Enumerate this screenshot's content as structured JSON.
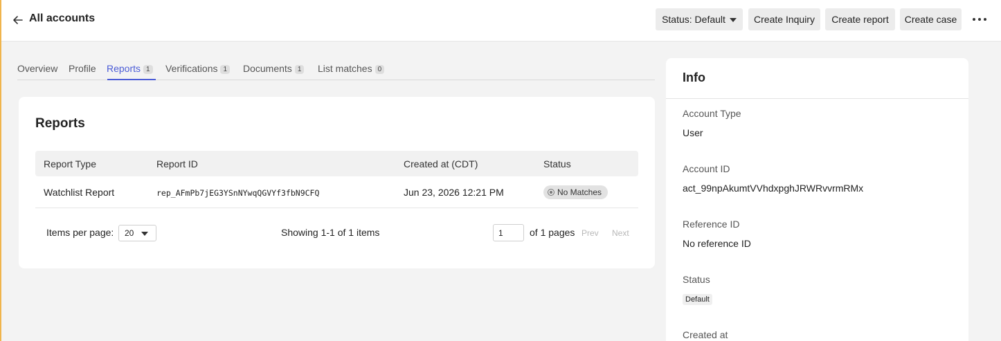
{
  "header": {
    "back_icon": "arrow-left-icon",
    "title": "All accounts",
    "status_button": "Status: Default",
    "create_inquiry": "Create Inquiry",
    "create_report": "Create report",
    "create_case": "Create case",
    "more_icon": "more-horizontal-icon"
  },
  "tabs": [
    {
      "label": "Overview",
      "count": null
    },
    {
      "label": "Profile",
      "count": null
    },
    {
      "label": "Reports",
      "count": "1",
      "active": true
    },
    {
      "label": "Verifications",
      "count": "1"
    },
    {
      "label": "Documents",
      "count": "1"
    },
    {
      "label": "List matches",
      "count": "0"
    }
  ],
  "reports": {
    "title": "Reports",
    "columns": [
      "Report Type",
      "Report ID",
      "Created at (CDT)",
      "Status"
    ],
    "rows": [
      {
        "type": "Watchlist Report",
        "id": "rep_AFmPb7jEG3YSnNYwqQGVYf3fbN9CFQ",
        "created": "Jun 23, 2026 12:21 PM",
        "status": "No Matches"
      }
    ],
    "pagination": {
      "items_per_page_label": "Items per page:",
      "items_per_page": "20",
      "showing": "Showing 1-1 of 1 items",
      "page": "1",
      "of_pages": "of 1 pages",
      "prev": "Prev",
      "next": "Next"
    }
  },
  "info": {
    "title": "Info",
    "account_type_label": "Account Type",
    "account_type": "User",
    "account_id_label": "Account ID",
    "account_id": "act_99npAkumtVVhdxpghJRWRvvrmRMx",
    "reference_id_label": "Reference ID",
    "reference_id": "No reference ID",
    "status_label": "Status",
    "status": "Default",
    "created_at_label": "Created at"
  },
  "colors": {
    "accent": "#4a5bd6",
    "left_border": "#f0b44c"
  }
}
